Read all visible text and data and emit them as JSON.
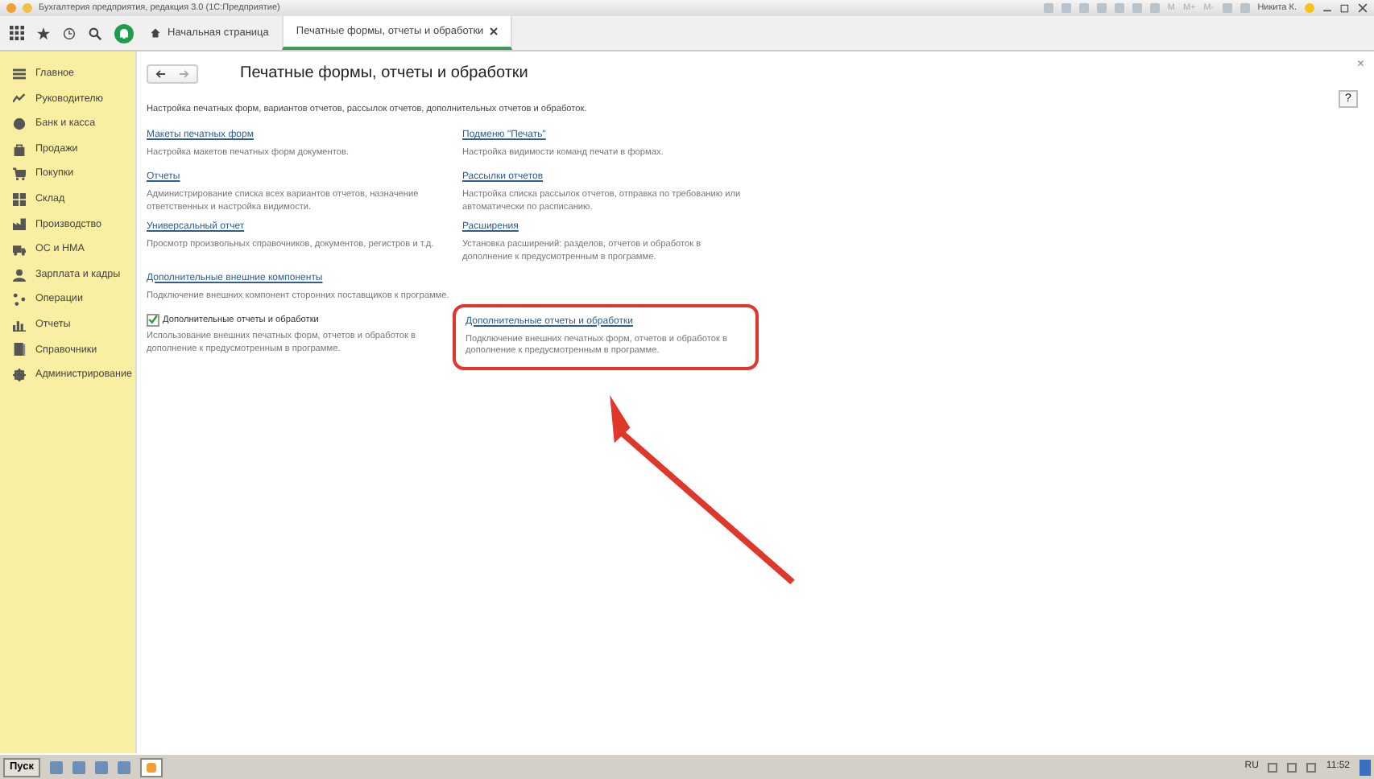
{
  "window": {
    "title": "Бухгалтерия предприятия, редакция 3.0 (1С:Предприятие)",
    "memory_buttons": [
      "M",
      "M+",
      "M-"
    ],
    "user": "Никита К."
  },
  "tabs": [
    {
      "label": "Начальная страница",
      "selected": false,
      "closable": false
    },
    {
      "label": "Печатные формы, отчеты и обработки",
      "selected": true,
      "closable": true
    }
  ],
  "sidebar": {
    "items": [
      {
        "label": "Главное"
      },
      {
        "label": "Руководителю"
      },
      {
        "label": "Банк и касса"
      },
      {
        "label": "Продажи"
      },
      {
        "label": "Покупки"
      },
      {
        "label": "Склад"
      },
      {
        "label": "Производство"
      },
      {
        "label": "ОС и НМА"
      },
      {
        "label": "Зарплата и кадры"
      },
      {
        "label": "Операции"
      },
      {
        "label": "Отчеты"
      },
      {
        "label": "Справочники"
      },
      {
        "label": "Администрирование"
      }
    ]
  },
  "page": {
    "title": "Печатные формы, отчеты и обработки",
    "description": "Настройка печатных форм, вариантов отчетов, рассылок отчетов, дополнительных отчетов и обработок.",
    "help": "?",
    "close": "×",
    "rows": [
      [
        {
          "kind": "link",
          "title": "Макеты печатных форм",
          "description": "Настройка макетов печатных форм документов.",
          "highlighted": false
        },
        {
          "kind": "link",
          "title": "Подменю \"Печать\"",
          "description": "Настройка видимости команд печати в формах.",
          "highlighted": false
        }
      ],
      [
        {
          "kind": "link",
          "title": "Отчеты",
          "description": "Администрирование списка всех вариантов отчетов, назначение ответственных и настройка видимости.",
          "highlighted": false
        },
        {
          "kind": "link",
          "title": "Рассылки отчетов",
          "description": "Настройка списка рассылок отчетов, отправка по требованию или автоматически по расписанию.",
          "highlighted": false
        }
      ],
      [
        {
          "kind": "link",
          "title": "Универсальный отчет",
          "description": "Просмотр произвольных справочников, документов, регистров и т.д.",
          "highlighted": false
        },
        {
          "kind": "link",
          "title": "Расширения",
          "description": "Установка расширений: разделов, отчетов и обработок в дополнение к предусмотренным в программе.",
          "highlighted": false
        }
      ],
      [
        {
          "kind": "link",
          "title": "Дополнительные внешние компоненты",
          "description": "Подключение внешних компонент сторонних поставщиков к программе.",
          "highlighted": false
        }
      ],
      [
        {
          "kind": "checkbox",
          "title": "Дополнительные отчеты и обработки",
          "checked": true,
          "description": "Использование внешних печатных форм, отчетов и обработок в дополнение к предусмотренным в программе.",
          "highlighted": false
        },
        {
          "kind": "link",
          "title": "Дополнительные отчеты и обработки",
          "description": "Подключение внешних печатных форм, отчетов и обработок в дополнение к предусмотренным в программе.",
          "highlighted": true
        }
      ]
    ]
  },
  "taskbar": {
    "start": "Пуск",
    "language": "RU",
    "time": "11:52"
  }
}
